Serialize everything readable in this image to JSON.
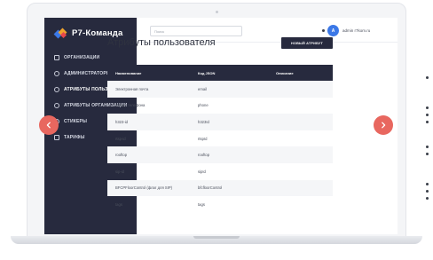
{
  "app": {
    "logo_text": "Р7-Команда"
  },
  "sidebar": {
    "items": [
      {
        "label": "ОРГАНИЗАЦИИ",
        "icon": "building-icon"
      },
      {
        "label": "АДМИНИСТРАТОРЫ",
        "icon": "user-icon"
      },
      {
        "label": "АТРИБУТЫ ПОЛЬЗОВАТЕЛЯ",
        "icon": "user-icon",
        "active": true
      },
      {
        "label": "АТРИБУТЫ ОРГАНИЗАЦИИ",
        "icon": "user-icon"
      },
      {
        "label": "СТИКЕРЫ",
        "icon": "sticker-icon"
      },
      {
        "label": "ТАРИФЫ",
        "icon": "tariff-icon"
      }
    ]
  },
  "topbar": {
    "search_placeholder": "Поиск",
    "avatar_letter": "A",
    "user_name": "admin r7kom.ru"
  },
  "page": {
    "title": "Атрибуты пользователя",
    "new_button": "НОВЫЙ АТРИБУТ"
  },
  "table": {
    "headers": [
      "Наименование",
      "Код JSON",
      "Описание"
    ],
    "rows": [
      [
        "Электронная почта",
        "email",
        ""
      ],
      [
        "Номер телефона",
        "phone",
        ""
      ],
      [
        "h323-id",
        "h323Id",
        ""
      ],
      [
        "rtsp-id",
        "rtspId",
        ""
      ],
      [
        "rooftop",
        "rooftop",
        ""
      ],
      [
        "sip-id",
        "sipId",
        ""
      ],
      [
        "BFCPFloorControl (флаг для SIP)",
        "bfcfloorControl",
        ""
      ],
      [
        "tags",
        "tags",
        ""
      ]
    ]
  },
  "colors": {
    "sidebar_bg": "#272a3e",
    "accent": "#3b78e7",
    "arrow": "#e8675f"
  }
}
